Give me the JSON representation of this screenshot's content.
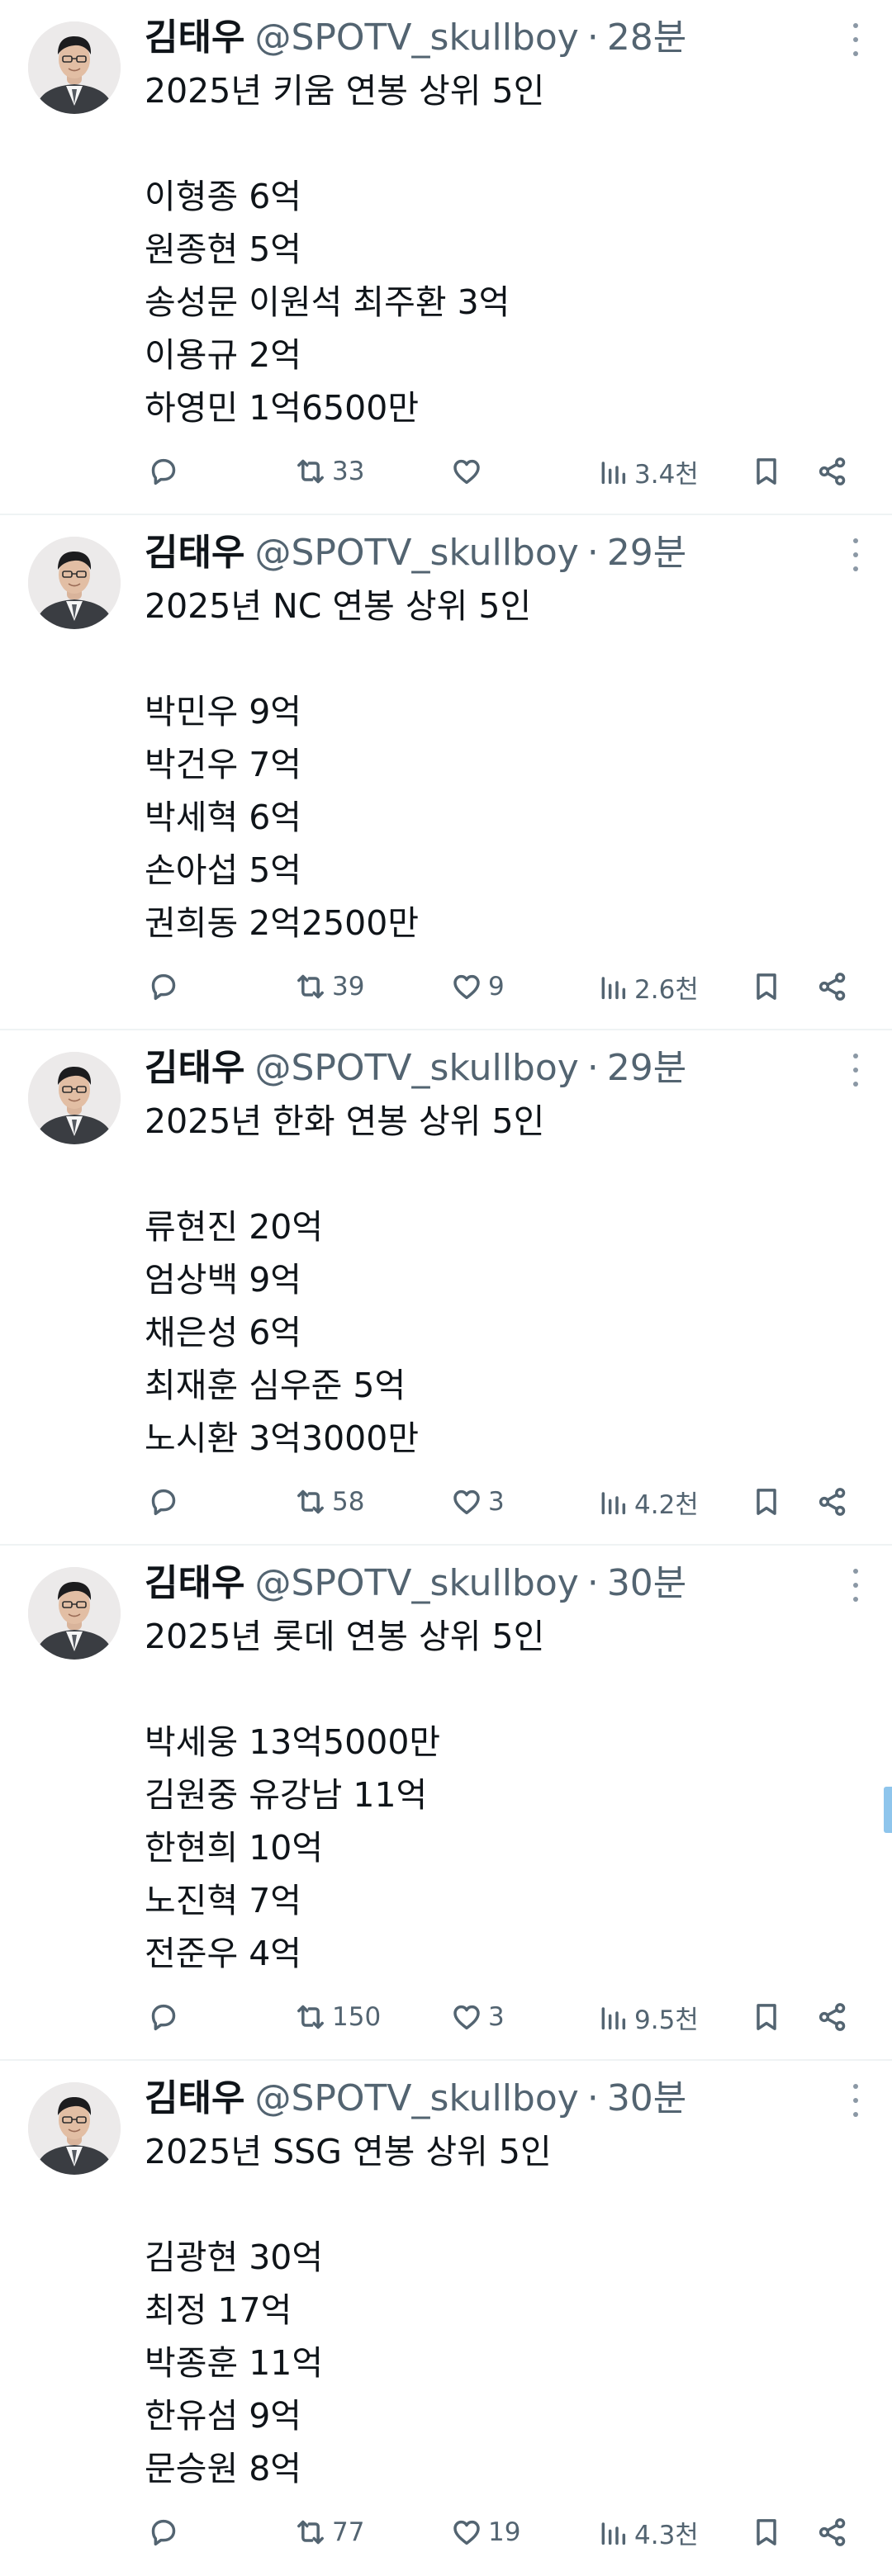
{
  "tweets": [
    {
      "author_name": "김태우",
      "handle": "@SPOTV_skullboy",
      "separator": "·",
      "time": "28분",
      "lines": [
        "2025년 키움 연봉 상위 5인",
        "",
        "이형종 6억",
        "원종현 5억",
        "송성문 이원석 최주환 3억",
        "이용규 2억",
        "하영민 1억6500만"
      ],
      "reply_count": "",
      "retweet_count": "33",
      "like_count": "",
      "view_count": "3.4천"
    },
    {
      "author_name": "김태우",
      "handle": "@SPOTV_skullboy",
      "separator": "·",
      "time": "29분",
      "lines": [
        "2025년 NC 연봉 상위 5인",
        "",
        "박민우 9억",
        "박건우 7억",
        "박세혁 6억",
        "손아섭 5억",
        "권희동 2억2500만"
      ],
      "reply_count": "",
      "retweet_count": "39",
      "like_count": "9",
      "view_count": "2.6천"
    },
    {
      "author_name": "김태우",
      "handle": "@SPOTV_skullboy",
      "separator": "·",
      "time": "29분",
      "lines": [
        "2025년 한화 연봉 상위 5인",
        "",
        "류현진 20억",
        "엄상백 9억",
        "채은성 6억",
        "최재훈 심우준 5억",
        "노시환 3억3000만"
      ],
      "reply_count": "",
      "retweet_count": "58",
      "like_count": "3",
      "view_count": "4.2천"
    },
    {
      "author_name": "김태우",
      "handle": "@SPOTV_skullboy",
      "separator": "·",
      "time": "30분",
      "lines": [
        "2025년 롯데 연봉 상위 5인",
        "",
        "박세웅 13억5000만",
        "김원중 유강남 11억",
        "한현희 10억",
        "노진혁 7억",
        "전준우 4억"
      ],
      "reply_count": "",
      "retweet_count": "150",
      "like_count": "3",
      "view_count": "9.5천"
    },
    {
      "author_name": "김태우",
      "handle": "@SPOTV_skullboy",
      "separator": "·",
      "time": "30분",
      "lines": [
        "2025년 SSG 연봉 상위 5인",
        "",
        "김광현 30억",
        "최정 17억",
        "박종훈 11억",
        "한유섬 9억",
        "문승원 8억"
      ],
      "reply_count": "",
      "retweet_count": "77",
      "like_count": "19",
      "view_count": "4.3천"
    }
  ],
  "icons": {
    "reply": "reply-icon",
    "retweet": "retweet-icon",
    "like": "heart-icon",
    "views": "views-icon",
    "bookmark": "bookmark-icon",
    "share": "share-icon",
    "more": "more-icon"
  },
  "colors": {
    "text": "#0f1419",
    "secondary": "#536471",
    "divider": "#eff3f4",
    "scrollbar": "#8ec5ec"
  }
}
